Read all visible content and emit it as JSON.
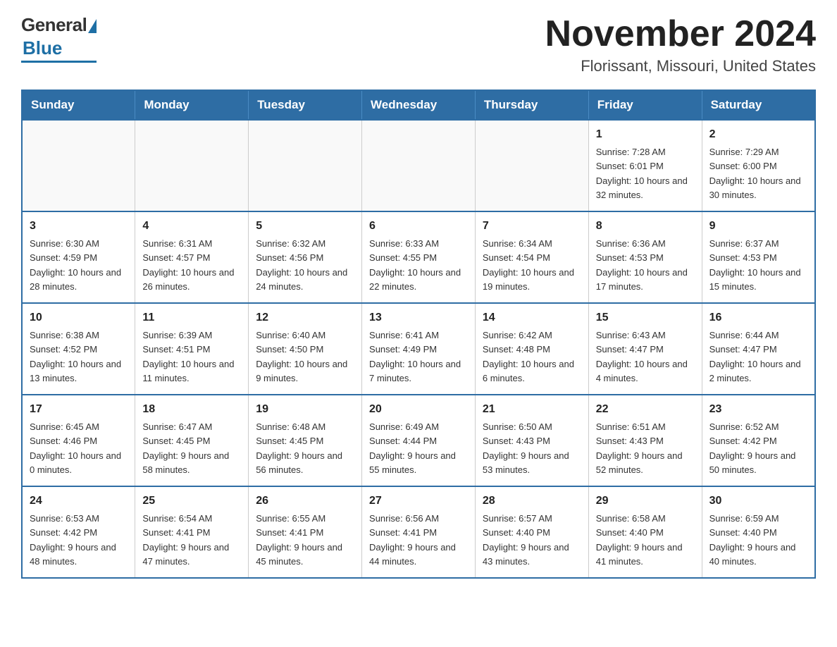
{
  "header": {
    "logo_general": "General",
    "logo_blue": "Blue",
    "month_title": "November 2024",
    "location": "Florissant, Missouri, United States"
  },
  "calendar": {
    "days_of_week": [
      "Sunday",
      "Monday",
      "Tuesday",
      "Wednesday",
      "Thursday",
      "Friday",
      "Saturday"
    ],
    "weeks": [
      [
        {
          "day": "",
          "info": ""
        },
        {
          "day": "",
          "info": ""
        },
        {
          "day": "",
          "info": ""
        },
        {
          "day": "",
          "info": ""
        },
        {
          "day": "",
          "info": ""
        },
        {
          "day": "1",
          "info": "Sunrise: 7:28 AM\nSunset: 6:01 PM\nDaylight: 10 hours and 32 minutes."
        },
        {
          "day": "2",
          "info": "Sunrise: 7:29 AM\nSunset: 6:00 PM\nDaylight: 10 hours and 30 minutes."
        }
      ],
      [
        {
          "day": "3",
          "info": "Sunrise: 6:30 AM\nSunset: 4:59 PM\nDaylight: 10 hours and 28 minutes."
        },
        {
          "day": "4",
          "info": "Sunrise: 6:31 AM\nSunset: 4:57 PM\nDaylight: 10 hours and 26 minutes."
        },
        {
          "day": "5",
          "info": "Sunrise: 6:32 AM\nSunset: 4:56 PM\nDaylight: 10 hours and 24 minutes."
        },
        {
          "day": "6",
          "info": "Sunrise: 6:33 AM\nSunset: 4:55 PM\nDaylight: 10 hours and 22 minutes."
        },
        {
          "day": "7",
          "info": "Sunrise: 6:34 AM\nSunset: 4:54 PM\nDaylight: 10 hours and 19 minutes."
        },
        {
          "day": "8",
          "info": "Sunrise: 6:36 AM\nSunset: 4:53 PM\nDaylight: 10 hours and 17 minutes."
        },
        {
          "day": "9",
          "info": "Sunrise: 6:37 AM\nSunset: 4:53 PM\nDaylight: 10 hours and 15 minutes."
        }
      ],
      [
        {
          "day": "10",
          "info": "Sunrise: 6:38 AM\nSunset: 4:52 PM\nDaylight: 10 hours and 13 minutes."
        },
        {
          "day": "11",
          "info": "Sunrise: 6:39 AM\nSunset: 4:51 PM\nDaylight: 10 hours and 11 minutes."
        },
        {
          "day": "12",
          "info": "Sunrise: 6:40 AM\nSunset: 4:50 PM\nDaylight: 10 hours and 9 minutes."
        },
        {
          "day": "13",
          "info": "Sunrise: 6:41 AM\nSunset: 4:49 PM\nDaylight: 10 hours and 7 minutes."
        },
        {
          "day": "14",
          "info": "Sunrise: 6:42 AM\nSunset: 4:48 PM\nDaylight: 10 hours and 6 minutes."
        },
        {
          "day": "15",
          "info": "Sunrise: 6:43 AM\nSunset: 4:47 PM\nDaylight: 10 hours and 4 minutes."
        },
        {
          "day": "16",
          "info": "Sunrise: 6:44 AM\nSunset: 4:47 PM\nDaylight: 10 hours and 2 minutes."
        }
      ],
      [
        {
          "day": "17",
          "info": "Sunrise: 6:45 AM\nSunset: 4:46 PM\nDaylight: 10 hours and 0 minutes."
        },
        {
          "day": "18",
          "info": "Sunrise: 6:47 AM\nSunset: 4:45 PM\nDaylight: 9 hours and 58 minutes."
        },
        {
          "day": "19",
          "info": "Sunrise: 6:48 AM\nSunset: 4:45 PM\nDaylight: 9 hours and 56 minutes."
        },
        {
          "day": "20",
          "info": "Sunrise: 6:49 AM\nSunset: 4:44 PM\nDaylight: 9 hours and 55 minutes."
        },
        {
          "day": "21",
          "info": "Sunrise: 6:50 AM\nSunset: 4:43 PM\nDaylight: 9 hours and 53 minutes."
        },
        {
          "day": "22",
          "info": "Sunrise: 6:51 AM\nSunset: 4:43 PM\nDaylight: 9 hours and 52 minutes."
        },
        {
          "day": "23",
          "info": "Sunrise: 6:52 AM\nSunset: 4:42 PM\nDaylight: 9 hours and 50 minutes."
        }
      ],
      [
        {
          "day": "24",
          "info": "Sunrise: 6:53 AM\nSunset: 4:42 PM\nDaylight: 9 hours and 48 minutes."
        },
        {
          "day": "25",
          "info": "Sunrise: 6:54 AM\nSunset: 4:41 PM\nDaylight: 9 hours and 47 minutes."
        },
        {
          "day": "26",
          "info": "Sunrise: 6:55 AM\nSunset: 4:41 PM\nDaylight: 9 hours and 45 minutes."
        },
        {
          "day": "27",
          "info": "Sunrise: 6:56 AM\nSunset: 4:41 PM\nDaylight: 9 hours and 44 minutes."
        },
        {
          "day": "28",
          "info": "Sunrise: 6:57 AM\nSunset: 4:40 PM\nDaylight: 9 hours and 43 minutes."
        },
        {
          "day": "29",
          "info": "Sunrise: 6:58 AM\nSunset: 4:40 PM\nDaylight: 9 hours and 41 minutes."
        },
        {
          "day": "30",
          "info": "Sunrise: 6:59 AM\nSunset: 4:40 PM\nDaylight: 9 hours and 40 minutes."
        }
      ]
    ]
  }
}
